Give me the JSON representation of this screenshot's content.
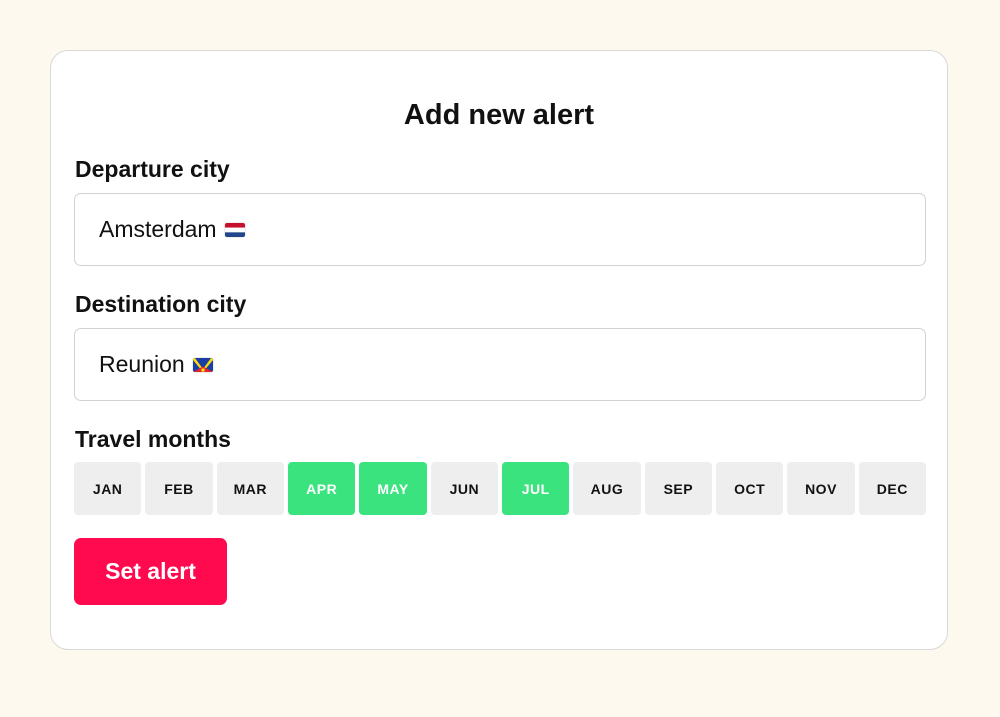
{
  "form": {
    "title": "Add new alert",
    "departure": {
      "label": "Departure city",
      "value": "Amsterdam",
      "flag_icon": "netherlands-flag-icon"
    },
    "destination": {
      "label": "Destination city",
      "value": "Reunion",
      "flag_icon": "reunion-flag-icon"
    },
    "travel_months": {
      "label": "Travel months",
      "months": [
        {
          "label": "JAN",
          "selected": false
        },
        {
          "label": "FEB",
          "selected": false
        },
        {
          "label": "MAR",
          "selected": false
        },
        {
          "label": "APR",
          "selected": true
        },
        {
          "label": "MAY",
          "selected": true
        },
        {
          "label": "JUN",
          "selected": false
        },
        {
          "label": "JUL",
          "selected": true
        },
        {
          "label": "AUG",
          "selected": false
        },
        {
          "label": "SEP",
          "selected": false
        },
        {
          "label": "OCT",
          "selected": false
        },
        {
          "label": "NOV",
          "selected": false
        },
        {
          "label": "DEC",
          "selected": false
        }
      ]
    },
    "submit_label": "Set alert"
  },
  "colors": {
    "page_background": "#fdf9ef",
    "selected_month": "#3be37f",
    "unselected_month": "#eeeeee",
    "primary_button": "#ff0a4e"
  }
}
